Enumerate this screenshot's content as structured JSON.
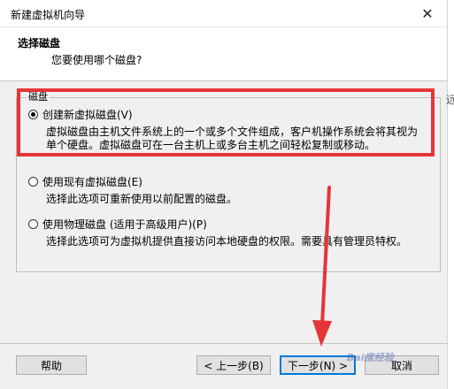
{
  "window": {
    "title": "新建虚拟机向导"
  },
  "header": {
    "title": "选择磁盘",
    "subtitle": "您要使用哪个磁盘?"
  },
  "group": {
    "label": "磁盘"
  },
  "options": [
    {
      "label": "创建新虚拟磁盘(V)",
      "selected": true,
      "desc1": "虚拟磁盘由主机文件系统上的一个或多个文件组成，客户机操作系统会将其视为",
      "desc2": "单个硬盘。虚拟磁盘可在一台主机上或多台主机之间轻松复制或移动。"
    },
    {
      "label": "使用现有虚拟磁盘(E)",
      "selected": false,
      "desc1": "选择此选项可重新使用以前配置的磁盘。"
    },
    {
      "label": "使用物理磁盘 (适用于高级用户)(P)",
      "selected": false,
      "desc1": "选择此选项可为虚拟机提供直接访问本地硬盘的权限。需要具有管理员特权。"
    }
  ],
  "buttons": {
    "help": "帮助",
    "back": "< 上一步(B)",
    "next": "下一步(N) >",
    "cancel": "取消"
  },
  "annotation": {
    "highlight_color": "#e53537"
  },
  "watermark": {
    "text": "Bai度经验"
  },
  "edge": {
    "glyph": "远"
  }
}
